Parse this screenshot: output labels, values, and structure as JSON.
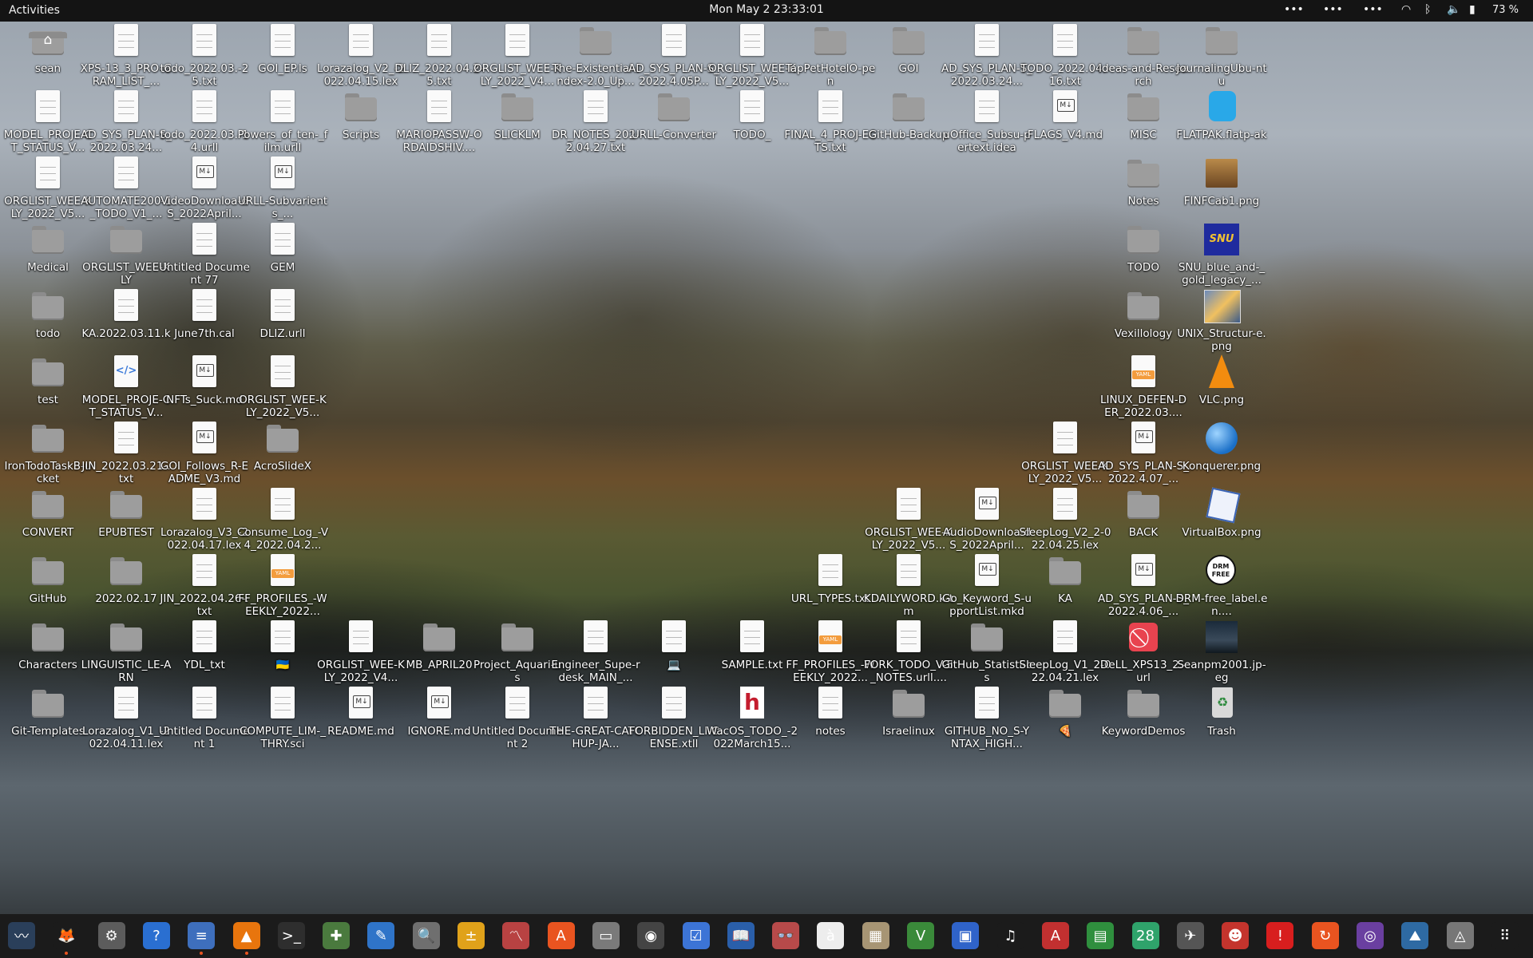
{
  "topbar": {
    "activities": "Activities",
    "clock": "Mon May 2  23:33:01",
    "indicators": [
      "•••",
      "•••",
      "•••"
    ],
    "battery": "73 %"
  },
  "desktop": [
    {
      "label": "sean",
      "kind": "folder-home"
    },
    {
      "label": "XPS-13_3_PRO-GRAM_LIST_...",
      "kind": "file"
    },
    {
      "label": "todo_2022.03.-25.txt",
      "kind": "file"
    },
    {
      "label": "GOI_EP.ls",
      "kind": "file"
    },
    {
      "label": "Lorazalog_V2_-2022.04.15.lex",
      "kind": "file"
    },
    {
      "label": "DLIZ_2022.04.2-5.txt",
      "kind": "file"
    },
    {
      "label": "ORGLIST_WEE-KLY_2022_V4...",
      "kind": "file"
    },
    {
      "label": "The-Existential-index-2.0_Up...",
      "kind": "folder"
    },
    {
      "label": "AD_SYS_PLAN-S_2022.4.05P...",
      "kind": "file"
    },
    {
      "label": "ORGLIST_WEE-KLY_2022_V5...",
      "kind": "file"
    },
    {
      "label": "TapPetHotelO-pen",
      "kind": "folder"
    },
    {
      "label": "GOI",
      "kind": "folder"
    },
    {
      "label": "AD_SYS_PLAN-S_2022.03.24...",
      "kind": "file"
    },
    {
      "label": "TODO_2022.04.-16.txt",
      "kind": "file"
    },
    {
      "label": "Ideas-and-Research",
      "kind": "folder"
    },
    {
      "label": "JournalingUbu-ntu",
      "kind": "folder"
    },
    {
      "label": "MODEL_PROJE-CT_STATUS_V...",
      "kind": "file"
    },
    {
      "label": "AD_SYS_PLAN-S_2022.03.24...",
      "kind": "file"
    },
    {
      "label": "todo_2022.03.-14.urll",
      "kind": "file"
    },
    {
      "label": "Powers_of_ten-_film.urll",
      "kind": "file"
    },
    {
      "label": "Scripts",
      "kind": "folder"
    },
    {
      "label": "MARIOPASSW-ORDAIDSHIV....",
      "kind": "file"
    },
    {
      "label": "SLICKLM",
      "kind": "folder"
    },
    {
      "label": "DR_NOTES_202-2.04.27.txt",
      "kind": "file"
    },
    {
      "label": "URLL-Converter",
      "kind": "folder"
    },
    {
      "label": "TODO_",
      "kind": "file"
    },
    {
      "label": "FINAL_4_PROJ-ECTS.txt",
      "kind": "file"
    },
    {
      "label": "GitHub-Backup",
      "kind": "folder"
    },
    {
      "label": "uOffice_Subsu-pertext.idea",
      "kind": "file"
    },
    {
      "label": "FLAGS_V4.md",
      "kind": "md"
    },
    {
      "label": "MISC",
      "kind": "folder"
    },
    {
      "label": "FLATPAK.flatp-ak",
      "kind": "box"
    },
    {
      "label": "ORGLIST_WEE-KLY_2022_V5...",
      "kind": "file"
    },
    {
      "label": "AUTOMATE200-1_TODO_V1_...",
      "kind": "file"
    },
    {
      "label": "VideoDownloa-dS_2022April...",
      "kind": "md"
    },
    {
      "label": "URLL-Subvarients_...",
      "kind": "md"
    },
    {
      "label": "Notes",
      "kind": "folder"
    },
    {
      "label": "FINFCab1.png",
      "kind": "cab"
    },
    {
      "label": "Medical",
      "kind": "folder"
    },
    {
      "label": "ORGLIST_WEE-KLY",
      "kind": "folder"
    },
    {
      "label": "Untitled Document 77",
      "kind": "file"
    },
    {
      "label": "GEM",
      "kind": "file"
    },
    {
      "label": "TODO",
      "kind": "folder"
    },
    {
      "label": "SNU_blue_and-_gold_legacy_...",
      "kind": "snu"
    },
    {
      "label": "todo",
      "kind": "folder"
    },
    {
      "label": "KA.2022.03.11.k",
      "kind": "file"
    },
    {
      "label": "June7th.cal",
      "kind": "file"
    },
    {
      "label": "DLIZ.urll",
      "kind": "file"
    },
    {
      "label": "Vexillology",
      "kind": "folder"
    },
    {
      "label": "UNIX_Structur-e.png",
      "kind": "img"
    },
    {
      "label": "test",
      "kind": "folder"
    },
    {
      "label": "MODEL_PROJE-CT_STATUS_V...",
      "kind": "code"
    },
    {
      "label": "NFTs_Suck.md",
      "kind": "md"
    },
    {
      "label": "ORGLIST_WEE-KLY_2022_V5...",
      "kind": "file"
    },
    {
      "label": "LINUX_DEFEN-DER_2022.03....",
      "kind": "yaml"
    },
    {
      "label": "VLC.png",
      "kind": "vlc"
    },
    {
      "label": "IronTodoTaskB-ucket",
      "kind": "folder"
    },
    {
      "label": "JIN_2022.03.21-.txt",
      "kind": "file"
    },
    {
      "label": "GOI_Follows_R-EADME_V3.md",
      "kind": "md"
    },
    {
      "label": "AcroSlideX",
      "kind": "folder"
    },
    {
      "label": "ORGLIST_WEE-KLY_2022_V5...",
      "kind": "file"
    },
    {
      "label": "AD_SYS_PLAN-S_2022.4.07_...",
      "kind": "md"
    },
    {
      "label": "Konquerer.png",
      "kind": "globe"
    },
    {
      "label": "CONVERT",
      "kind": "folder"
    },
    {
      "label": "EPUBTEST",
      "kind": "folder"
    },
    {
      "label": "Lorazalog_V3_-2022.04.17.lex",
      "kind": "file"
    },
    {
      "label": "Consume_Log_-V4_2022.04.2...",
      "kind": "file"
    },
    {
      "label": "ORGLIST_WEE-KLY_2022_V5...",
      "kind": "file"
    },
    {
      "label": "AudioDownloa-dS_2022April...",
      "kind": "md"
    },
    {
      "label": "SleepLog_V2_2-022.04.25.lex",
      "kind": "file"
    },
    {
      "label": "BACK",
      "kind": "folder"
    },
    {
      "label": "VirtualBox.png",
      "kind": "vbox"
    },
    {
      "label": "GitHub",
      "kind": "folder"
    },
    {
      "label": "2022.02.17",
      "kind": "folder"
    },
    {
      "label": "JIN_2022.04.26-.txt",
      "kind": "file"
    },
    {
      "label": "FF_PROFILES_-WEEKLY_2022...",
      "kind": "yaml"
    },
    {
      "label": "URL_TYPES.txt",
      "kind": "file"
    },
    {
      "label": "KDAILYWORD.k-tm",
      "kind": "file"
    },
    {
      "label": "Go_Keyword_S-upportList.mkd",
      "kind": "md"
    },
    {
      "label": "KA",
      "kind": "folder"
    },
    {
      "label": "AD_SYS_PLAN-S_2022.4.06_...",
      "kind": "md"
    },
    {
      "label": "DRM-free_label.en....",
      "kind": "drm"
    },
    {
      "label": "Characters",
      "kind": "folder"
    },
    {
      "label": "LINGUISTIC_LE-ARN",
      "kind": "folder"
    },
    {
      "label": "YDL_txt",
      "kind": "file"
    },
    {
      "label": "🇺🇦",
      "kind": "file"
    },
    {
      "label": "ORGLIST_WEE-KLY_2022_V4...",
      "kind": "file"
    },
    {
      "label": "MB_APRIL20",
      "kind": "folder"
    },
    {
      "label": "Project_Aquari-us",
      "kind": "folder"
    },
    {
      "label": "Engineer_Supe-rdesk_MAIN_...",
      "kind": "file"
    },
    {
      "label": "💻",
      "kind": "file"
    },
    {
      "label": "SAMPLE.txt",
      "kind": "file"
    },
    {
      "label": "FF_PROFILES_-WEEKLY_2022...",
      "kind": "yaml"
    },
    {
      "label": "FORK_TODO_V-5_NOTES.urll....",
      "kind": "file"
    },
    {
      "label": "GitHub_Statisti-cs",
      "kind": "folder"
    },
    {
      "label": "SleepLog_V1_2-022.04.21.lex",
      "kind": "file"
    },
    {
      "label": "DeLL_XPS13_2.-url",
      "kind": "ban"
    },
    {
      "label": "Seanpm2001.jp-eg",
      "kind": "photo"
    },
    {
      "label": "Git-Templates",
      "kind": "folder"
    },
    {
      "label": "Lorazalog_V1_-2022.04.11.lex",
      "kind": "file"
    },
    {
      "label": "Untitled Document 1",
      "kind": "file"
    },
    {
      "label": "COMPUTE_LIM-_THRY.sci",
      "kind": "file"
    },
    {
      "label": "README.md",
      "kind": "md"
    },
    {
      "label": "IGNORE.md",
      "kind": "md"
    },
    {
      "label": "Untitled Document 2",
      "kind": "file"
    },
    {
      "label": "THE-GREAT-CATCHUP-JA...",
      "kind": "file"
    },
    {
      "label": "FORBIDDEN_LI-CENSE.xtll",
      "kind": "file"
    },
    {
      "label": "WacOS_TODO_-2022March15...",
      "kind": "h"
    },
    {
      "label": "notes",
      "kind": "file"
    },
    {
      "label": "Israelinux",
      "kind": "folder"
    },
    {
      "label": "GITHUB_NO_S-YNTAX_HIGH...",
      "kind": "file"
    },
    {
      "label": "🍕",
      "kind": "folder"
    },
    {
      "label": "KeywordDemos",
      "kind": "folder"
    },
    {
      "label": "Trash",
      "kind": "trash"
    }
  ],
  "dock": [
    {
      "name": "system-monitor",
      "glyph": "〰",
      "color": "#2a3f5a",
      "running": false
    },
    {
      "name": "firefox",
      "glyph": "🦊",
      "color": "#1b1b1b",
      "running": true
    },
    {
      "name": "settings",
      "glyph": "⚙",
      "color": "#5c5c5c",
      "running": false
    },
    {
      "name": "help",
      "glyph": "?",
      "color": "#2a6fd1",
      "running": false
    },
    {
      "name": "text-editor",
      "glyph": "≡",
      "color": "#3e6fbd",
      "running": true
    },
    {
      "name": "vlc",
      "glyph": "▲",
      "color": "#e8750d",
      "running": true
    },
    {
      "name": "terminal",
      "glyph": ">_",
      "color": "#2e2e2e",
      "running": false
    },
    {
      "name": "game",
      "glyph": "✚",
      "color": "#4a7a3e",
      "running": false
    },
    {
      "name": "gedit",
      "glyph": "✎",
      "color": "#2f74c8",
      "running": false
    },
    {
      "name": "image-viewer",
      "glyph": "🔍",
      "color": "#6f6f6f",
      "running": false
    },
    {
      "name": "calculator",
      "glyph": "±",
      "color": "#e0a21a",
      "running": false
    },
    {
      "name": "monitor",
      "glyph": "〽",
      "color": "#b84242",
      "running": false
    },
    {
      "name": "software",
      "glyph": "A",
      "color": "#e95420",
      "running": false
    },
    {
      "name": "files",
      "glyph": "▭",
      "color": "#7a7a7a",
      "running": false
    },
    {
      "name": "disc",
      "glyph": "◉",
      "color": "#444",
      "running": false
    },
    {
      "name": "tasks",
      "glyph": "☑",
      "color": "#3c74d6",
      "running": false
    },
    {
      "name": "dictionary",
      "glyph": "📖",
      "color": "#2a5faa",
      "running": false
    },
    {
      "name": "reader",
      "glyph": "👓",
      "color": "#b74a4a",
      "running": false
    },
    {
      "name": "characters",
      "glyph": "à",
      "color": "#ededed",
      "running": false
    },
    {
      "name": "archive",
      "glyph": "▦",
      "color": "#a79574",
      "running": false
    },
    {
      "name": "vim",
      "glyph": "V",
      "color": "#3a8a3a",
      "running": false
    },
    {
      "name": "screen",
      "glyph": "▣",
      "color": "#2f63c9",
      "running": false
    },
    {
      "name": "music",
      "glyph": "♫",
      "color": "#1b1b1b",
      "running": false
    },
    {
      "name": "pdf",
      "glyph": "A",
      "color": "#c23030",
      "running": false
    },
    {
      "name": "spreadsheet",
      "glyph": "▤",
      "color": "#2f8f3e",
      "running": false
    },
    {
      "name": "calendar",
      "glyph": "28",
      "color": "#2fa36b",
      "running": false
    },
    {
      "name": "bird",
      "glyph": "✈",
      "color": "#555",
      "running": false
    },
    {
      "name": "mario",
      "glyph": "☻",
      "color": "#c4342d",
      "running": false
    },
    {
      "name": "alert",
      "glyph": "!",
      "color": "#d81e1e",
      "running": false
    },
    {
      "name": "update",
      "glyph": "↻",
      "color": "#e95420",
      "running": false
    },
    {
      "name": "screenshot",
      "glyph": "◎",
      "color": "#6a3fa0",
      "running": false
    },
    {
      "name": "map",
      "glyph": "⛰",
      "color": "#2e6aa3",
      "running": false
    },
    {
      "name": "snap",
      "glyph": "◬",
      "color": "#777",
      "running": false
    },
    {
      "name": "app-grid",
      "glyph": "⠿",
      "color": "#1b1b1b",
      "running": false
    }
  ]
}
